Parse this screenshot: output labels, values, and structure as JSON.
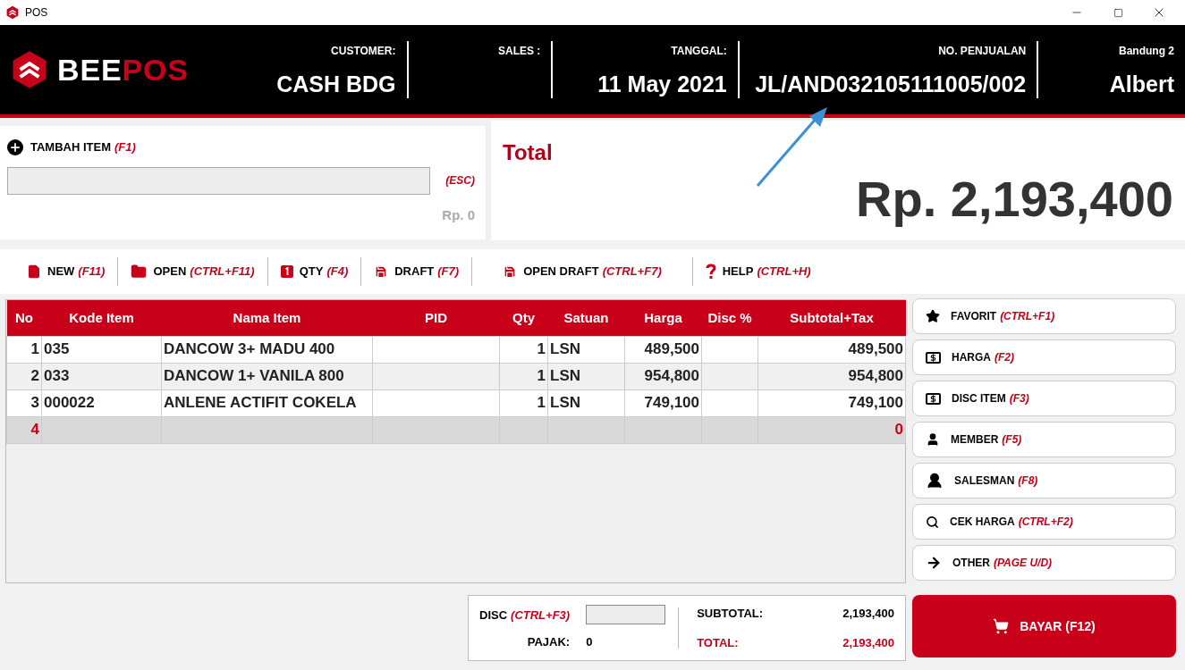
{
  "window": {
    "title": "POS"
  },
  "header": {
    "logo": {
      "part_1": "BEE",
      "part_2": "POS"
    },
    "fields": [
      {
        "label": "CUSTOMER:",
        "value": "CASH BDG"
      },
      {
        "label": "SALES :"
      },
      {
        "label": "TANGGAL:",
        "value": "11 May 2021"
      },
      {
        "label": "NO. PENJUALAN",
        "value": "JL/AND032105111005/002"
      },
      {
        "label": "Bandung 2",
        "value": "Albert"
      }
    ]
  },
  "add_item": {
    "label": "TAMBAH ITEM",
    "shortcut": "(F1)",
    "clear_shortcut": "(ESC)",
    "price": "Rp. 0"
  },
  "total": {
    "label": "Total",
    "amount": "Rp. 2,193,400"
  },
  "toolbar": [
    {
      "label": "NEW",
      "shortcut": "(F11)"
    },
    {
      "label": "OPEN",
      "shortcut": "(CTRL+F11)"
    },
    {
      "label": "QTY",
      "shortcut": "(F4)"
    },
    {
      "label": "DRAFT",
      "shortcut": "(F7)"
    },
    {
      "label": "OPEN DRAFT",
      "shortcut": "(CTRL+F7)"
    },
    {
      "label": "HELP",
      "shortcut": "(CTRL+H)"
    }
  ],
  "table": {
    "columns": [
      "No",
      "Kode Item",
      "Nama Item",
      "PID",
      "Qty",
      "Satuan",
      "Harga",
      "Disc %",
      "Subtotal+Tax"
    ],
    "rows": [
      {
        "kind": "item",
        "no": "1",
        "kode": "035",
        "nama": "DANCOW 3+ MADU 400",
        "qty": "1",
        "satuan": "LSN",
        "harga": "489,500",
        "subtotal": "489,500"
      },
      {
        "kind": "item",
        "no": "2",
        "kode": "033",
        "nama": "DANCOW 1+ VANILA 800",
        "qty": "1",
        "satuan": "LSN",
        "harga": "954,800",
        "subtotal": "954,800"
      },
      {
        "kind": "item",
        "no": "3",
        "kode": "000022",
        "nama": "ANLENE ACTIFIT COKELA",
        "qty": "1",
        "satuan": "LSN",
        "harga": "749,100",
        "subtotal": "749,100"
      },
      {
        "kind": "new",
        "no": "4",
        "subtotal": "0"
      }
    ]
  },
  "side_buttons": [
    {
      "label": "FAVORIT",
      "shortcut": "(CTRL+F1)"
    },
    {
      "label": "HARGA",
      "shortcut": "(F2)"
    },
    {
      "label": "DISC ITEM",
      "shortcut": "(F3)"
    },
    {
      "label": "MEMBER",
      "shortcut": "(F5)"
    },
    {
      "label": "SALESMAN",
      "shortcut": "(F8)"
    },
    {
      "label": "CEK HARGA",
      "shortcut": "(CTRL+F2)"
    },
    {
      "label": "OTHER",
      "shortcut": "(PAGE U/D)"
    }
  ],
  "summary": {
    "disc_label": "DISC",
    "disc_shortcut": "(CTRL+F3)",
    "pajak_label": "PAJAK:",
    "pajak_value": "0",
    "subtotal_label": "SUBTOTAL:",
    "subtotal_value": "2,193,400",
    "total_label": "TOTAL:",
    "total_value": "2,193,400"
  },
  "pay_button": {
    "label": "BAYAR (F12)"
  }
}
